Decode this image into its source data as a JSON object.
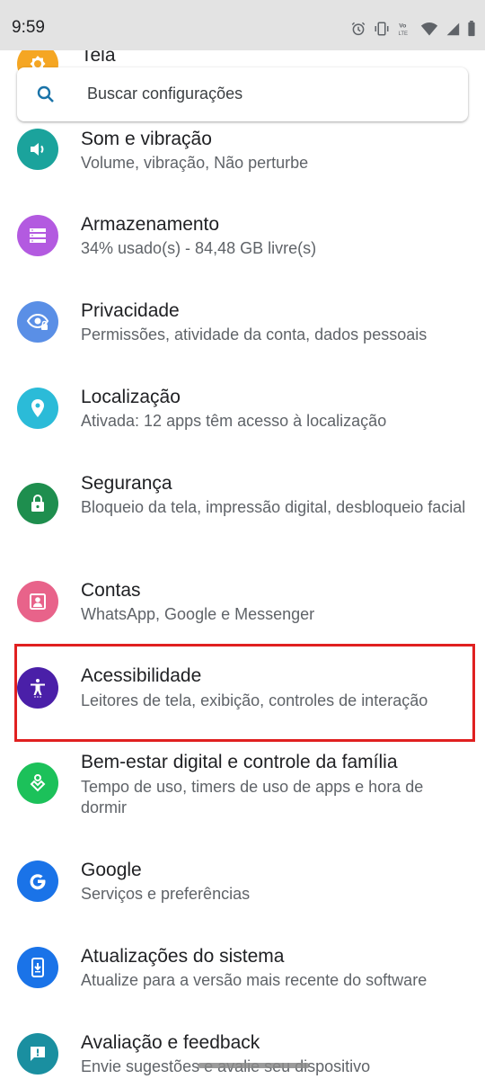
{
  "status": {
    "time": "9:59",
    "network_label": "Vo LTE"
  },
  "search": {
    "placeholder": "Buscar configurações"
  },
  "items": [
    {
      "title": "Tela",
      "subtitle": "",
      "icon": "display-icon",
      "color": "#f5a623"
    },
    {
      "title": "Som e vibração",
      "subtitle": "Volume, vibração, Não perturbe",
      "icon": "volume-icon",
      "color": "#1ba39c"
    },
    {
      "title": "Armazenamento",
      "subtitle": "34% usado(s) - 84,48 GB livre(s)",
      "icon": "storage-icon",
      "color": "#b35ae0"
    },
    {
      "title": "Privacidade",
      "subtitle": "Permissões, atividade da conta, dados pessoais",
      "icon": "privacy-eye-icon",
      "color": "#5a8fe6"
    },
    {
      "title": "Localização",
      "subtitle": "Ativada: 12 apps têm acesso à localização",
      "icon": "location-pin-icon",
      "color": "#2bbbd8"
    },
    {
      "title": "Segurança",
      "subtitle": "Bloqueio da tela, impressão digital, desbloqueio facial",
      "icon": "lock-icon",
      "color": "#1e8e4e"
    },
    {
      "title": "Contas",
      "subtitle": "WhatsApp, Google e Messenger",
      "icon": "account-box-icon",
      "color": "#e8638a"
    },
    {
      "title": "Acessibilidade",
      "subtitle": "Leitores de tela, exibição, controles de interação",
      "icon": "accessibility-icon",
      "color": "#4a1fa8"
    },
    {
      "title": "Bem-estar digital e controle da família",
      "subtitle": "Tempo de uso, timers de uso de apps e hora de dormir",
      "icon": "wellbeing-icon",
      "color": "#1cc15a"
    },
    {
      "title": "Google",
      "subtitle": "Serviços e preferências",
      "icon": "google-g-icon",
      "color": "#1a73e8"
    },
    {
      "title": "Atualizações do sistema",
      "subtitle": "Atualize para a versão mais recente do software",
      "icon": "system-update-icon",
      "color": "#1a73e8"
    },
    {
      "title": "Avaliação e feedback",
      "subtitle": "Envie sugestões e avalie seu dispositivo",
      "icon": "feedback-icon",
      "color": "#1a8fa0"
    }
  ],
  "highlight_color": "#e02020"
}
